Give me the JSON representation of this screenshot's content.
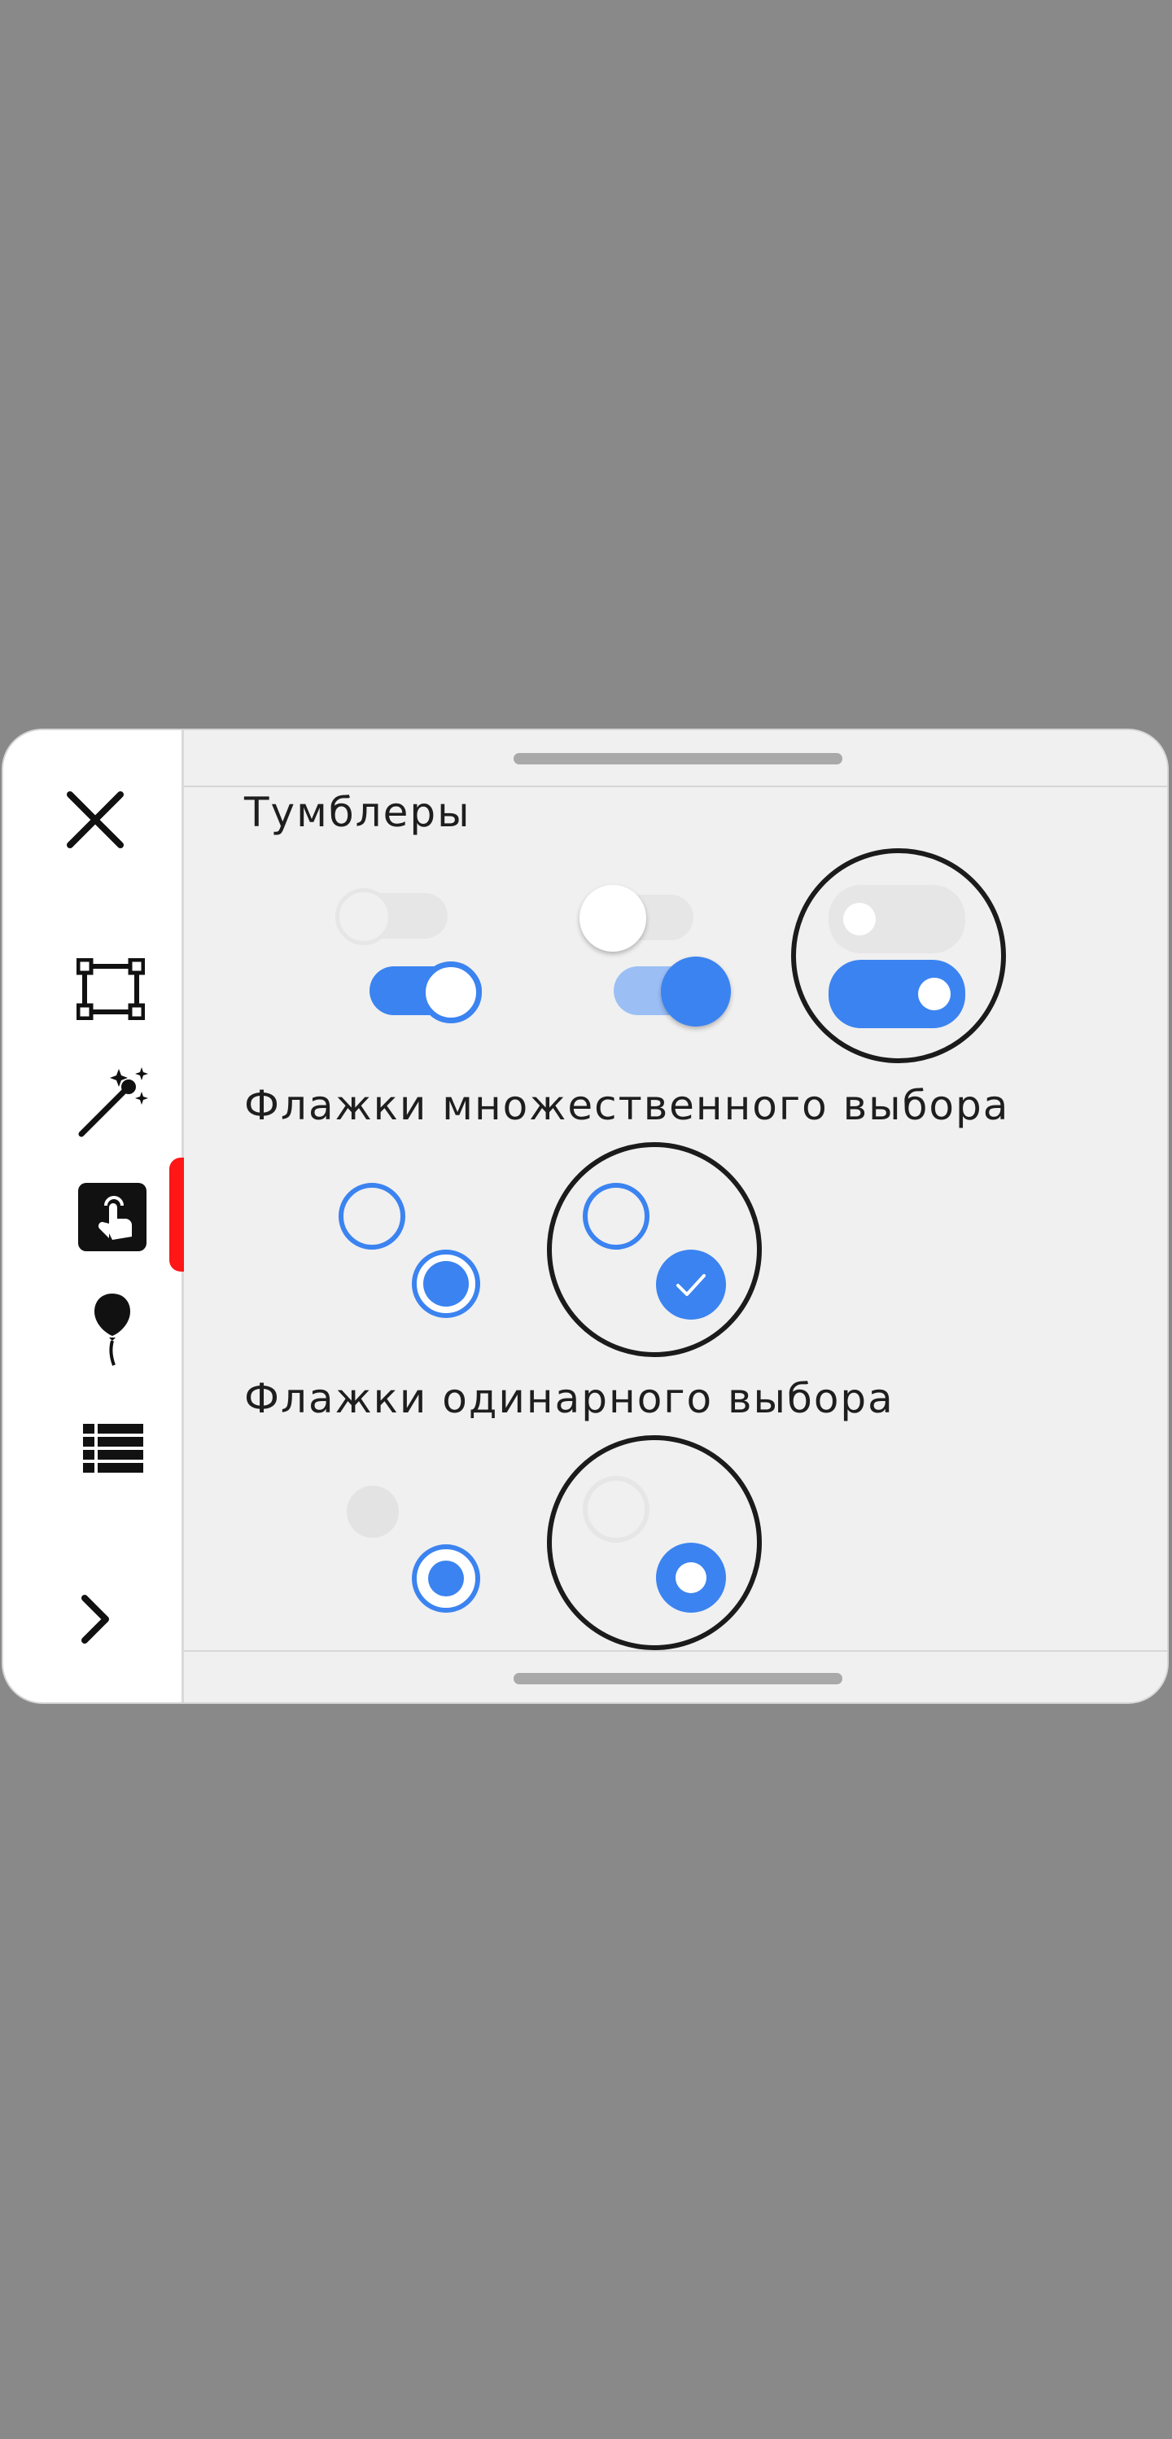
{
  "sidebar": {
    "items": [
      {
        "name": "close",
        "icon": "close-icon"
      },
      {
        "name": "selection",
        "icon": "select-frame-icon"
      },
      {
        "name": "magic",
        "icon": "magic-wand-icon"
      },
      {
        "name": "touch",
        "icon": "touch-gesture-icon",
        "active": true
      },
      {
        "name": "balloon",
        "icon": "balloon-icon"
      },
      {
        "name": "list",
        "icon": "list-icon"
      },
      {
        "name": "expand",
        "icon": "chevron-right-icon"
      }
    ]
  },
  "sections": {
    "toggles": {
      "title": "Тумблеры",
      "states": [
        "off-disabled",
        "on",
        "off-pressed",
        "on-pressed",
        "off-highlighted",
        "on-highlighted"
      ]
    },
    "checkboxes": {
      "title": "Флажки множественного выбора",
      "states": [
        "unchecked",
        "checked",
        "unchecked-highlighted",
        "checked-highlighted"
      ]
    },
    "radios": {
      "title": "Флажки одинарного выбора",
      "states": [
        "unselected-disabled",
        "selected",
        "unselected-highlighted",
        "selected-highlighted"
      ]
    }
  },
  "colors": {
    "accent": "#3b83f0",
    "accent_light": "#9bbff5",
    "track_off": "#e6e6e6",
    "active_marker": "#ff1616",
    "overlay": "#898989"
  }
}
